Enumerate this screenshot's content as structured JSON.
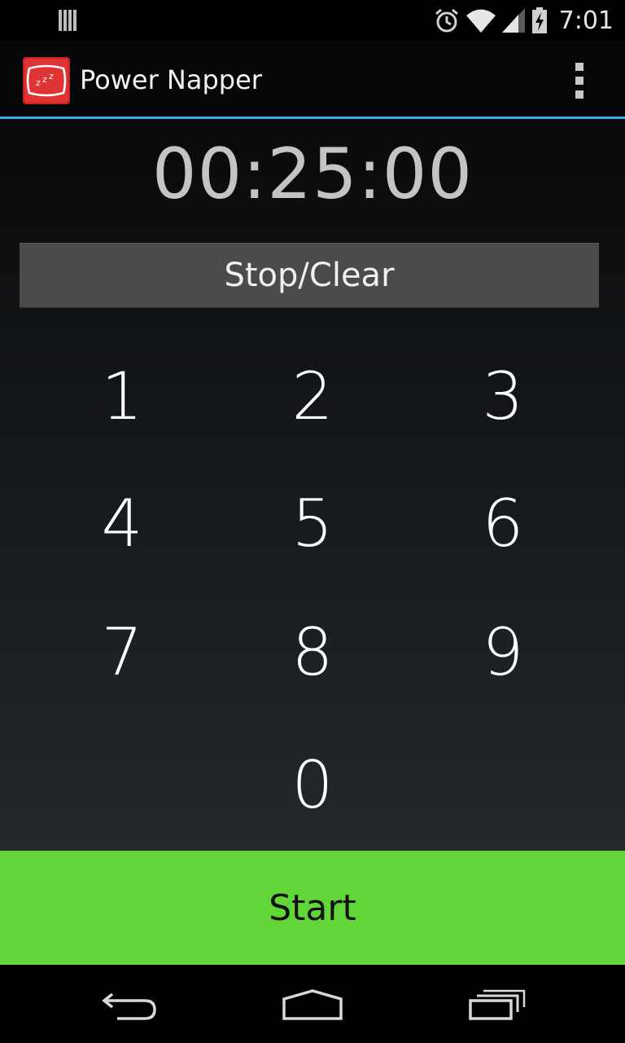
{
  "status_bar": {
    "time": "7:01",
    "icons": [
      "notification-bars-icon",
      "alarm-clock-icon",
      "wifi-icon",
      "cell-signal-icon",
      "battery-charging-icon"
    ]
  },
  "action_bar": {
    "title": "Power Napper",
    "app_icon": "sleeping-pillow-icon",
    "overflow_icon": "overflow-menu-icon"
  },
  "timer": {
    "value": "00:25:00"
  },
  "controls": {
    "stop_clear_label": "Stop/Clear",
    "start_label": "Start"
  },
  "keypad": {
    "keys": [
      "1",
      "2",
      "3",
      "4",
      "5",
      "6",
      "7",
      "8",
      "9",
      "0"
    ]
  },
  "nav_bar": {
    "icons": [
      "back-icon",
      "home-icon",
      "recent-apps-icon"
    ]
  },
  "colors": {
    "accent_line": "#33b5e5",
    "start_button": "#62d638",
    "stop_button": "#4a4b4c",
    "app_icon_red": "#d42a2a"
  }
}
